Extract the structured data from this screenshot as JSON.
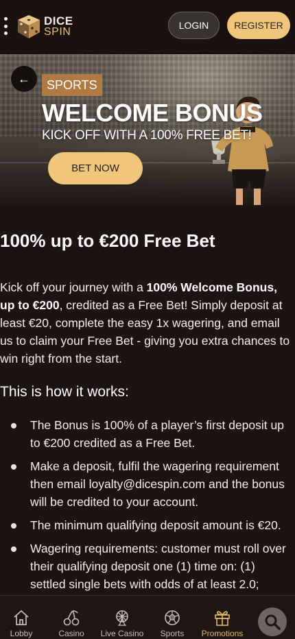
{
  "header": {
    "logo_line1": "DICE",
    "logo_line2": "SPIN",
    "login_label": "LOGIN",
    "register_label": "REGISTER"
  },
  "hero": {
    "tag": "SPORTS",
    "title": "WELCOME BONUS",
    "subtitle": "KICK OFF WITH A 100% FREE BET!",
    "cta_label": "BET NOW"
  },
  "main": {
    "heading": "100% up to €200 Free Bet",
    "intro": {
      "part1": "Kick off your journey with a ",
      "bold": "100% Welcome Bonus, up to €200",
      "part2": ", credited as a Free Bet! Simply deposit at least €20, complete the easy 1x wagering, and email us to claim your Free Bet - giving you extra chances to win right from the start."
    },
    "subheading": "This is how it works:",
    "bullets": [
      "The Bonus is 100% of a player’s first deposit up to €200 credited as a Free Bet.",
      "Make a deposit, fulfil the wagering requirement then email loyalty@dicespin.com and the bonus will be credited to your account.",
      "The minimum qualifying deposit amount is €20.",
      "Wagering requirements: customer must roll over their qualifying deposit one (1) time on: (1) settled single bets with odds of at least 2.0;"
    ]
  },
  "bottom_nav": {
    "items": [
      {
        "label": "Lobby",
        "icon": "home-icon"
      },
      {
        "label": "Casino",
        "icon": "cherries-icon"
      },
      {
        "label": "Live Casino",
        "icon": "ferris-wheel-icon"
      },
      {
        "label": "Sports",
        "icon": "soccer-ball-icon"
      },
      {
        "label": "Promotions",
        "icon": "gift-icon",
        "active": true
      }
    ],
    "search_icon": "search-icon"
  },
  "colors": {
    "accent": "#efc67c",
    "active_nav": "#e3b86a",
    "background": "#1c1412",
    "tag": "#b07a45"
  }
}
